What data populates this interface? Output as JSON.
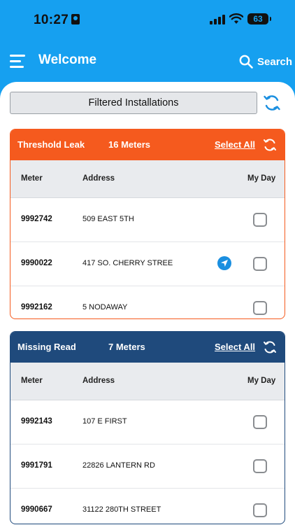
{
  "status_bar": {
    "time": "10:27",
    "battery": "63"
  },
  "header": {
    "title": "Welcome",
    "search_label": "Search"
  },
  "filter_button": "Filtered Installations",
  "columns": {
    "meter": "Meter",
    "address": "Address",
    "my_day": "My Day"
  },
  "colors": {
    "brand_blue": "#16a0f0",
    "leak_orange": "#f55a1e",
    "missing_navy": "#1f4a7c"
  },
  "groups": [
    {
      "title": "Threshold Leak",
      "count": "16 Meters",
      "select_all": "Select All",
      "rows": [
        {
          "meter": "9992742",
          "address": "509 EAST 5TH",
          "nav": false,
          "checked": false
        },
        {
          "meter": "9990022",
          "address": "417 SO. CHERRY STREE",
          "nav": true,
          "checked": false
        },
        {
          "meter": "9992162",
          "address": "5 NODAWAY",
          "nav": false,
          "checked": false
        }
      ]
    },
    {
      "title": "Missing Read",
      "count": "7 Meters",
      "select_all": "Select All",
      "rows": [
        {
          "meter": "9992143",
          "address": "107 E FIRST",
          "nav": false,
          "checked": false
        },
        {
          "meter": "9991791",
          "address": "22826 LANTERN RD",
          "nav": false,
          "checked": false
        },
        {
          "meter": "9990667",
          "address": "31122 280TH STREET",
          "nav": false,
          "checked": false
        }
      ]
    }
  ]
}
